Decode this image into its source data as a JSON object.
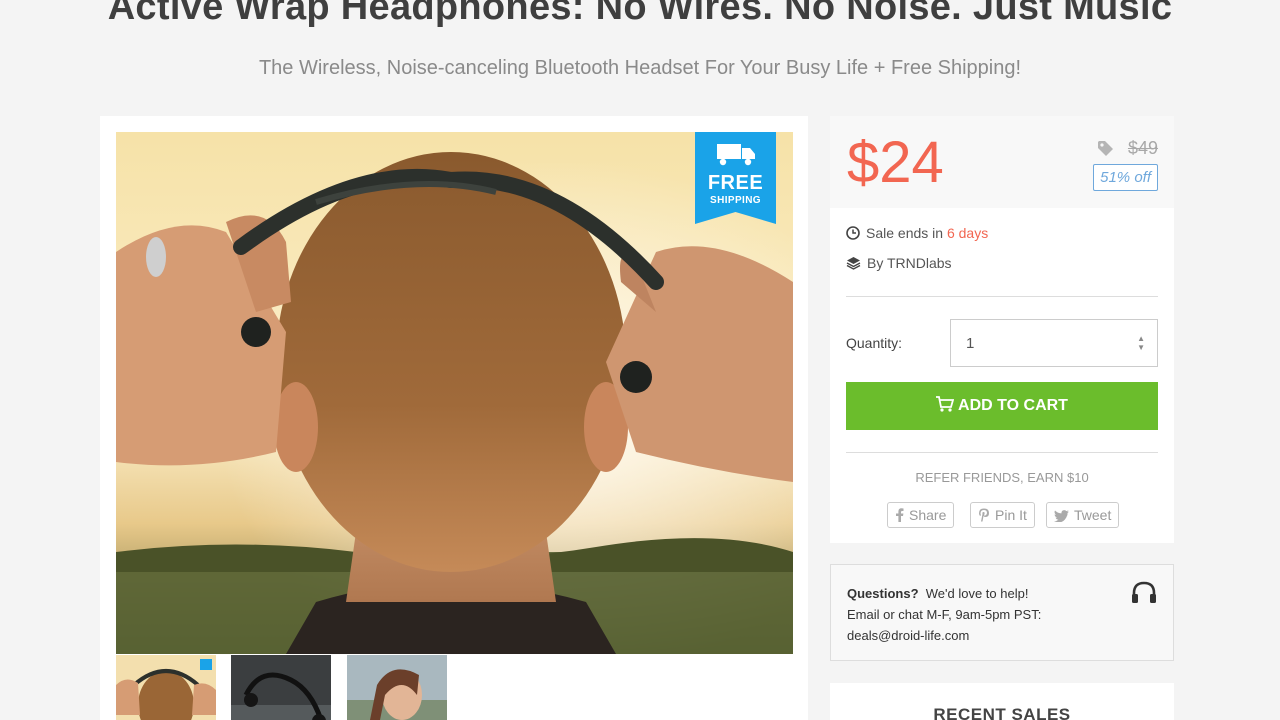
{
  "product": {
    "title": "Active Wrap Headphones: No Wires. No Noise. Just Music",
    "subtitle": "The Wireless, Noise-canceling Bluetooth Headset For Your Busy Life + Free Shipping!"
  },
  "badge": {
    "line1": "FREE",
    "line2": "SHIPPING"
  },
  "pricing": {
    "price": "$24",
    "old_price": "$49",
    "discount": "51% off"
  },
  "sale": {
    "prefix": "Sale ends in ",
    "remaining": "6 days",
    "by_label": "By TRNDlabs"
  },
  "quantity": {
    "label": "Quantity:",
    "value": "1"
  },
  "cart": {
    "label": "ADD TO CART"
  },
  "refer": {
    "label": "REFER FRIENDS, EARN $10",
    "share": "Share",
    "pin": "Pin It",
    "tweet": "Tweet"
  },
  "help": {
    "heading": "Questions?",
    "line1_rest": "We'd love to help!",
    "line2": "Email or chat M-F, 9am-5pm PST:",
    "email": "deals@droid-life.com"
  },
  "recent_sales": {
    "title": "RECENT SALES"
  },
  "colors": {
    "price": "#f26651",
    "cart_button": "#6bbd2c",
    "badge": "#1aa3e8",
    "discount_border": "#6fa8dc"
  },
  "icons": [
    "truck-icon",
    "tag-icon",
    "clock-icon",
    "layers-icon",
    "cart-icon",
    "facebook-icon",
    "pinterest-icon",
    "twitter-icon",
    "headset-icon"
  ]
}
